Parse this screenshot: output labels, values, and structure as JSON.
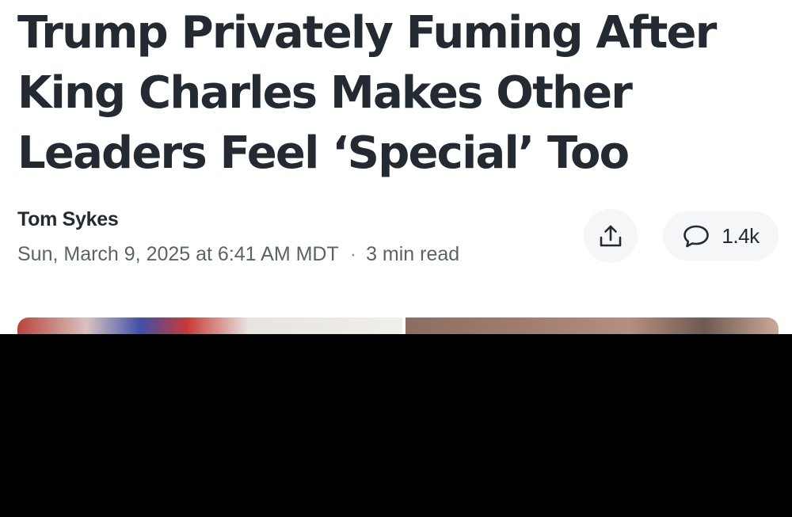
{
  "article": {
    "title": "Trump Privately Fuming After King Charles Makes Other Leaders Feel ‘Special’ Too",
    "author": "Tom Sykes",
    "date": "Sun, March 9, 2025 at 6:41 AM MDT",
    "separator": "·",
    "read_time": "3 min read"
  },
  "actions": {
    "share_icon": "share-icon",
    "comment_icon": "comment-bubble-icon",
    "comment_count": "1.4k"
  },
  "colors": {
    "text": "#232a31",
    "meta_text": "#5b636a",
    "button_bg": "#f4f6f8"
  }
}
